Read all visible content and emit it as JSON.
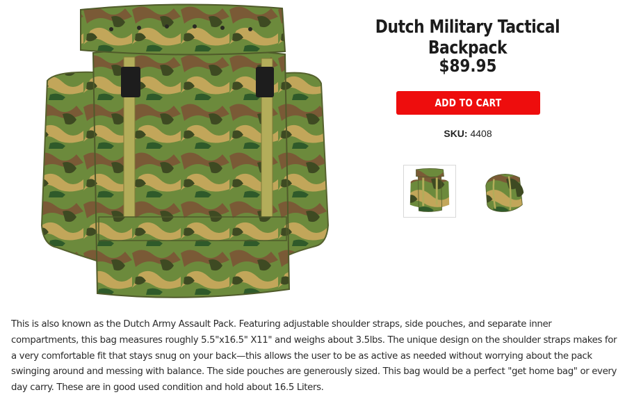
{
  "product": {
    "title": "Dutch Military Tactical Backpack",
    "price": "$89.95",
    "add_to_cart_label": "ADD TO CART",
    "sku_label": "SKU:",
    "sku_value": "4408",
    "description": "This is also known as the Dutch Army Assault Pack. Featuring adjustable shoulder straps, side pouches, and separate inner compartments, this bag measures roughly 5.5\"x16.5\" X11\" and weighs about 3.5lbs. The unique design on the shoulder straps makes for a very comfortable fit that stays snug on your back—this allows the user to be as active as needed without worrying about the pack swinging around and messing with balance. The side pouches are generously sized. This bag would be a perfect \"get home bag\" or every day carry. These are in good used condition and hold about 16.5 Liters."
  },
  "gallery": {
    "main_image": "backpack-front-image",
    "thumbnails": [
      "backpack-front-thumbnail",
      "backpack-angle-thumbnail"
    ]
  },
  "colors": {
    "button_red": "#ee0d0d",
    "camo_base": "#6b8a3a",
    "camo_dark": "#3e4a22",
    "camo_brown": "#7a5a36",
    "camo_tan": "#c2a65a"
  }
}
